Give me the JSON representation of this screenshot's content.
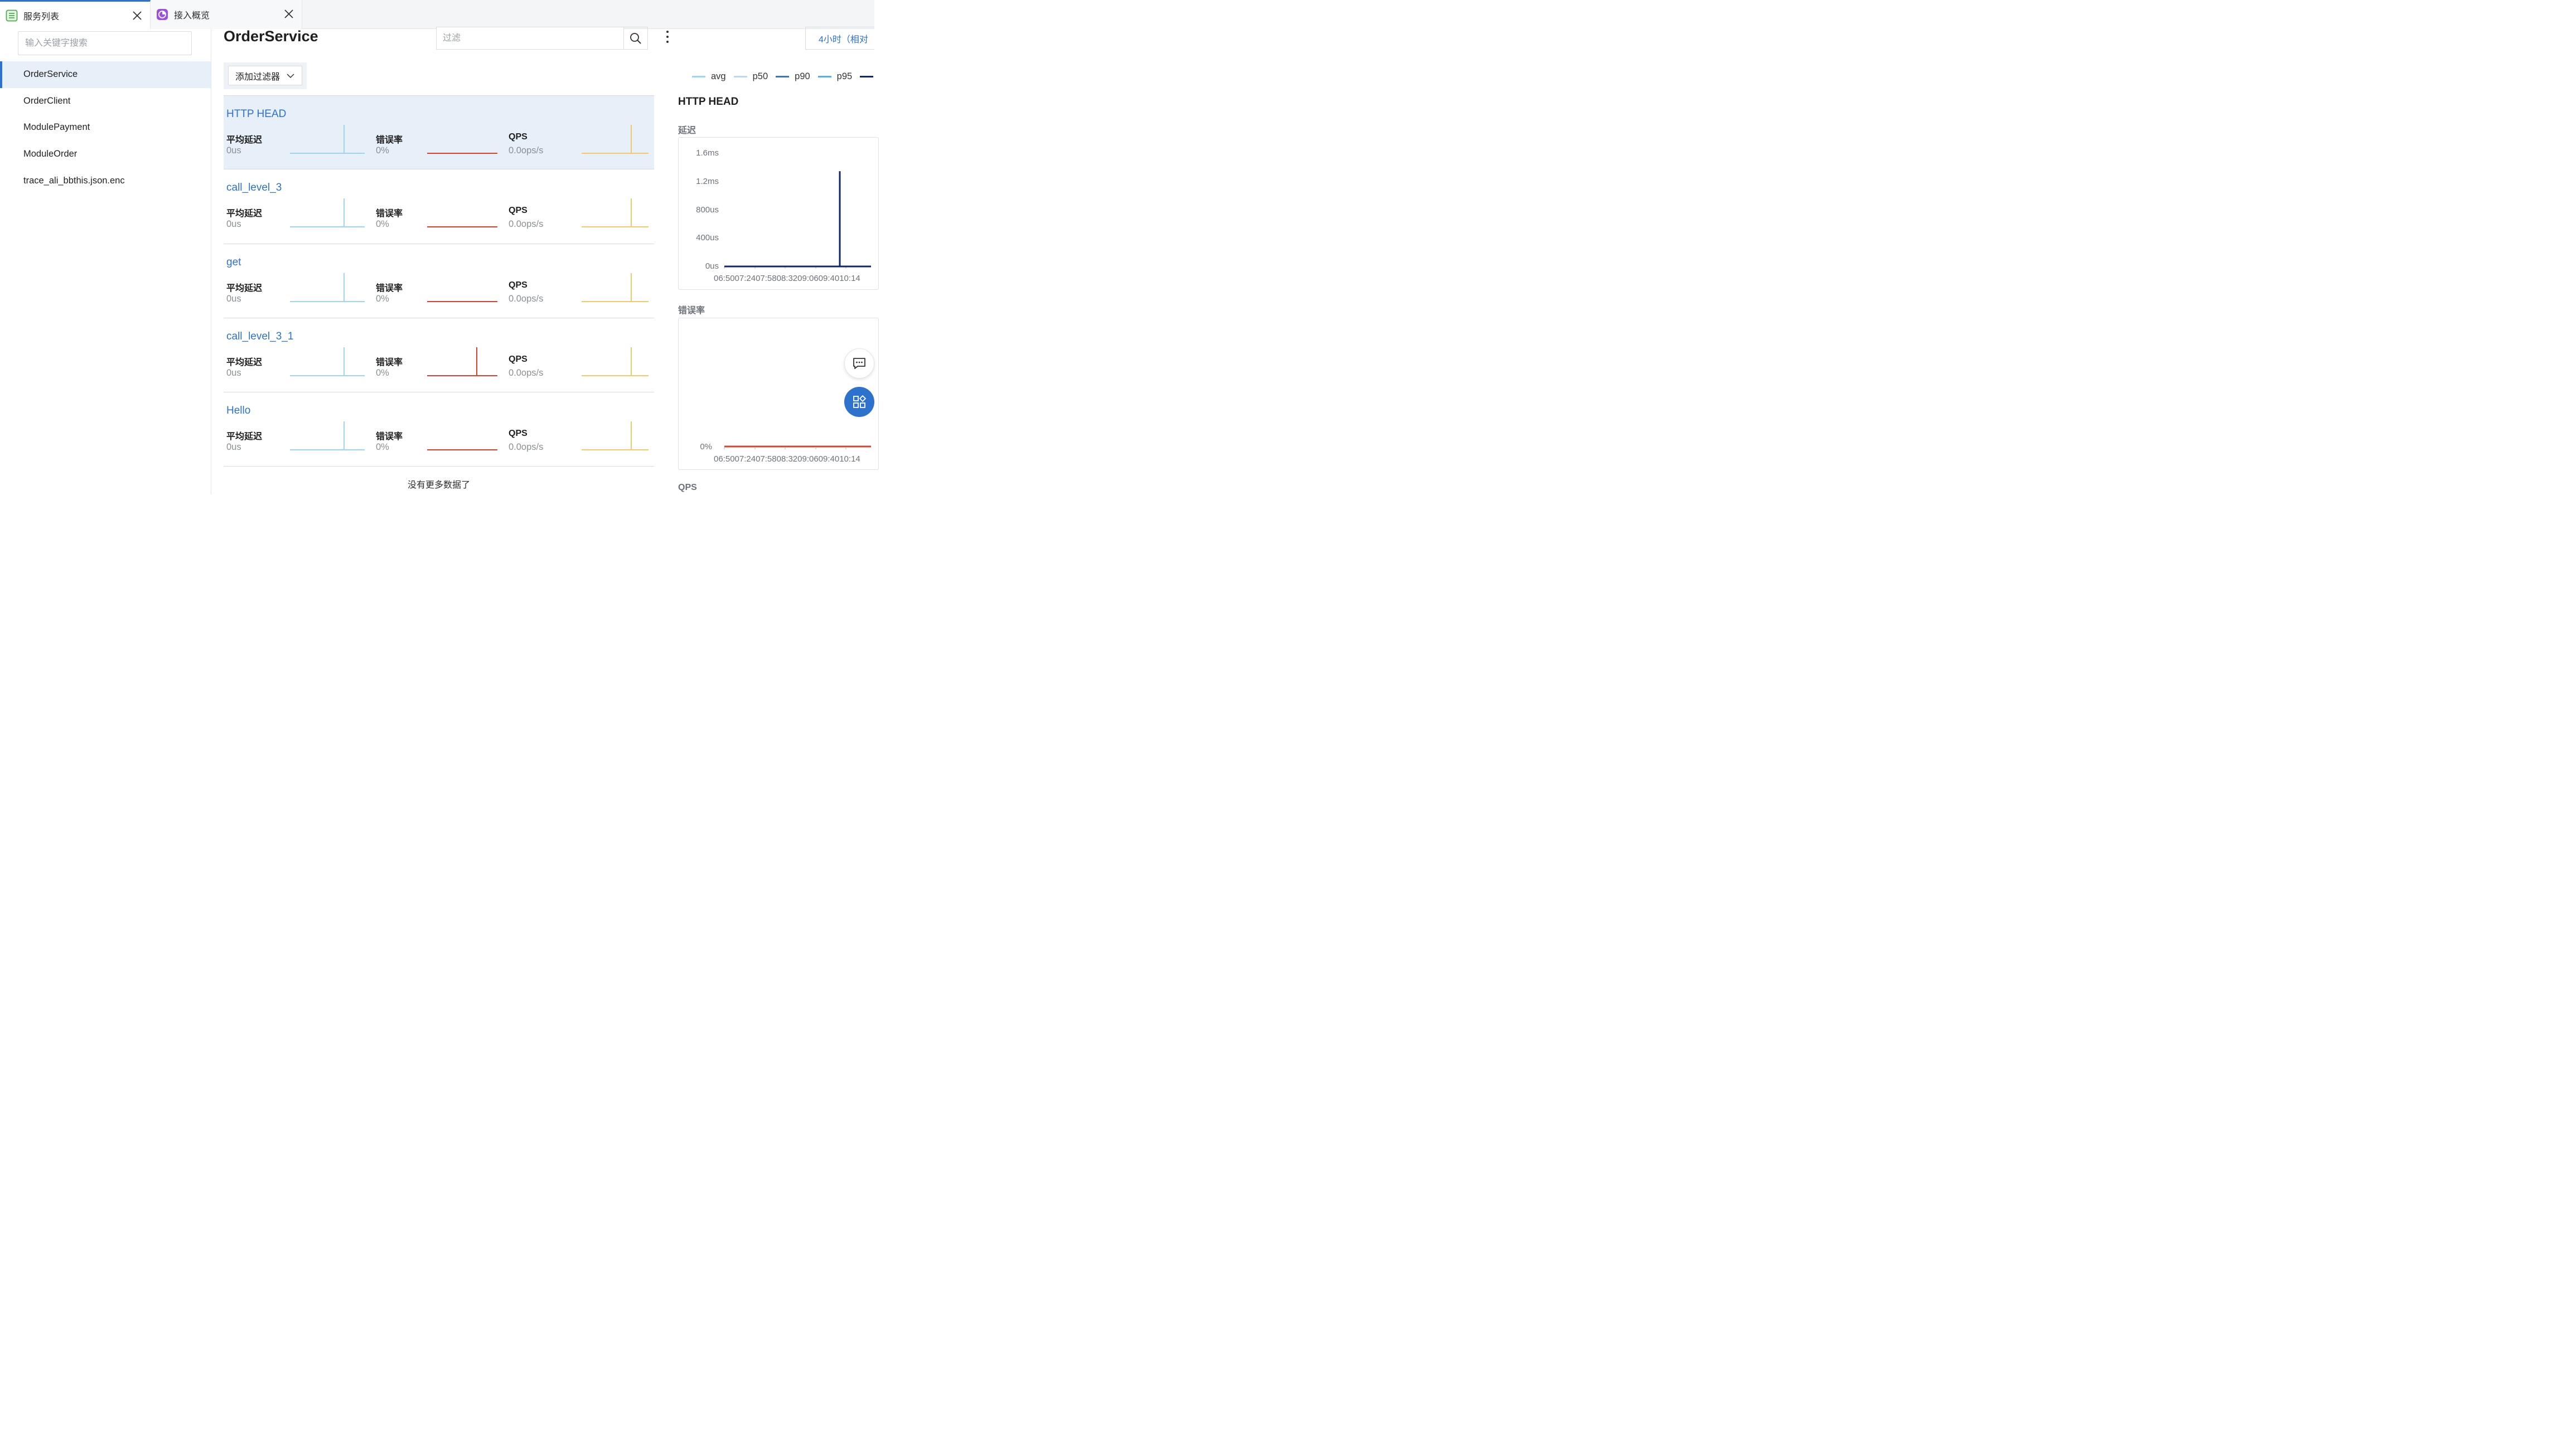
{
  "tabs": [
    {
      "label": "服务列表",
      "icon": "list-icon"
    },
    {
      "label": "接入概览",
      "icon": "pie-chart-icon"
    }
  ],
  "sidebar": {
    "search_placeholder": "输入关键字搜索",
    "items": [
      "OrderService",
      "OrderClient",
      "ModulePayment",
      "ModuleOrder",
      "trace_ali_bbthis.json.enc"
    ],
    "active_index": 0
  },
  "main": {
    "title": "OrderService",
    "filter_placeholder": "过滤",
    "time_range_label": "4小时（相对",
    "add_filter_label": "添加过滤器",
    "metric_labels": {
      "latency": "平均延迟",
      "error": "错误率",
      "qps": "QPS"
    },
    "endpoints": [
      {
        "name": "HTTP HEAD",
        "latency": "0us",
        "error": "0%",
        "qps": "0.0ops/s",
        "latency_spike": true,
        "error_spike": false,
        "qps_spike": true
      },
      {
        "name": "call_level_3",
        "latency": "0us",
        "error": "0%",
        "qps": "0.0ops/s",
        "latency_spike": true,
        "error_spike": false,
        "qps_spike": true
      },
      {
        "name": "get",
        "latency": "0us",
        "error": "0%",
        "qps": "0.0ops/s",
        "latency_spike": true,
        "error_spike": false,
        "qps_spike": true
      },
      {
        "name": "call_level_3_1",
        "latency": "0us",
        "error": "0%",
        "qps": "0.0ops/s",
        "latency_spike": true,
        "error_spike": true,
        "qps_spike": true
      },
      {
        "name": "Hello",
        "latency": "0us",
        "error": "0%",
        "qps": "0.0ops/s",
        "latency_spike": true,
        "error_spike": false,
        "qps_spike": true
      }
    ],
    "no_more_label": "没有更多数据了"
  },
  "detail": {
    "legend": [
      {
        "name": "avg",
        "color": "#9fd4f2"
      },
      {
        "name": "p50",
        "color": "#bcd9f3"
      },
      {
        "name": "p90",
        "color": "#3f73c7"
      },
      {
        "name": "p95",
        "color": "#5aaeea"
      },
      {
        "name": "",
        "color": "#10286b"
      }
    ],
    "title": "HTTP HEAD",
    "latency_label": "延迟",
    "error_label": "错误率",
    "qps_label": "QPS",
    "latency_yticks": [
      "1.6ms",
      "1.2ms",
      "800us",
      "400us",
      "0us"
    ],
    "error_yticks": [
      "0%"
    ],
    "xtick_label": "06:5007:2407:5808:3209:0609:4010:14"
  },
  "chart_data": [
    {
      "type": "line",
      "title": "延迟",
      "ylim": [
        "0us",
        "1.6ms"
      ],
      "yticks": [
        "0us",
        "400us",
        "800us",
        "1.2ms",
        "1.6ms"
      ],
      "x": [
        "06:50",
        "07:24",
        "07:58",
        "08:32",
        "09:06",
        "09:40",
        "10:14"
      ],
      "series": [
        {
          "name": "",
          "color": "#10286b",
          "note_spike_near": "09:40",
          "spike_value_us": 1340
        }
      ]
    },
    {
      "type": "line",
      "title": "错误率",
      "yticks": [
        "0%"
      ],
      "x": [
        "06:50",
        "07:24",
        "07:58",
        "08:32",
        "09:06",
        "09:40",
        "10:14"
      ],
      "series": [
        {
          "name": "",
          "color": "#d9412c",
          "values": [
            0,
            0,
            0,
            0,
            0,
            0,
            0
          ]
        }
      ]
    }
  ],
  "colors": {
    "accent": "#2d72cc",
    "latency": "#9fd4f2",
    "error": "#d9412c",
    "qps": "#f5c96a",
    "active_bg": "#e7eff9"
  }
}
